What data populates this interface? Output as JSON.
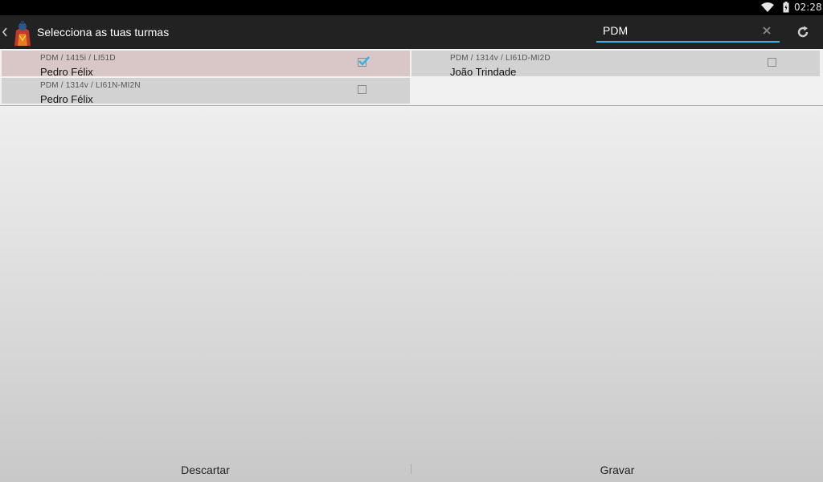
{
  "status_bar": {
    "time": "02:28",
    "icons": [
      "wifi-icon",
      "battery-icon"
    ]
  },
  "action_bar": {
    "title": "Selecciona as tuas turmas",
    "search": {
      "value": "PDM",
      "accent": "#33b5e5"
    },
    "icons": [
      "back-caret-icon",
      "app-logo",
      "clear-icon",
      "refresh-icon"
    ]
  },
  "classes": [
    {
      "code": "PDM / 1415i / LI51D",
      "teacher": "Pedro Félix",
      "checked": true
    },
    {
      "code": "PDM / 1314v / LI61D-MI2D",
      "teacher": "João Trindade",
      "checked": false
    },
    {
      "code": "PDM / 1314v / LI61N-MI2N",
      "teacher": "Pedro Félix",
      "checked": false
    }
  ],
  "actions": {
    "discard": "Descartar",
    "save": "Gravar"
  },
  "colors": {
    "selected_card": "#d9c7c8",
    "card": "#d2d2d2",
    "action_bar": "#222222"
  }
}
